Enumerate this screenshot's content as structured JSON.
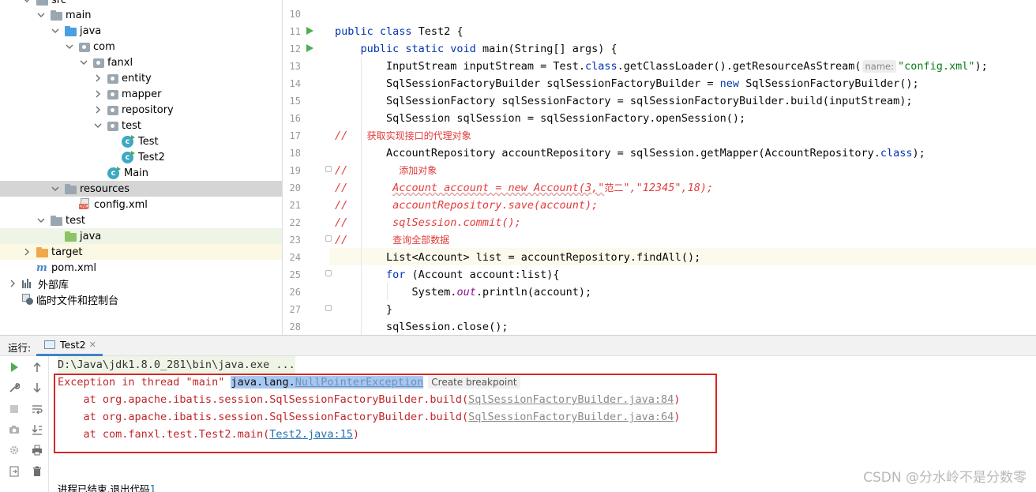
{
  "tree": {
    "items": [
      {
        "label": "src"
      },
      {
        "label": "main"
      },
      {
        "label": "java"
      },
      {
        "label": "com"
      },
      {
        "label": "fanxl"
      },
      {
        "label": "entity"
      },
      {
        "label": "mapper"
      },
      {
        "label": "repository"
      },
      {
        "label": "test"
      },
      {
        "label": "Test"
      },
      {
        "label": "Test2"
      },
      {
        "label": "Main"
      },
      {
        "label": "resources"
      },
      {
        "label": "config.xml"
      },
      {
        "label": "test"
      },
      {
        "label": "java"
      },
      {
        "label": "target"
      },
      {
        "label": "pom.xml"
      },
      {
        "label": "外部库"
      },
      {
        "label": "临时文件和控制台"
      }
    ]
  },
  "editor": {
    "line_numbers": [
      "10",
      "11",
      "12",
      "13",
      "14",
      "15",
      "16",
      "17",
      "18",
      "19",
      "20",
      "21",
      "22",
      "23",
      "24",
      "25",
      "26",
      "27",
      "28"
    ],
    "lines": {
      "l11_a": "public class",
      "l11_b": " Test2 {",
      "l12_a": "    public static void",
      "l12_b": " main(String[] args) {",
      "l13_a": "        InputStream inputStream = Test.",
      "l13_kw": "class",
      "l13_b": ".getClassLoader().getResourceAsStream(",
      "l13_hint": "name:",
      "l13_str": "\"config.xml\"",
      "l13_c": ");",
      "l14_a": "        SqlSessionFactoryBuilder sqlSessionFactoryBuilder = ",
      "l14_kw": "new",
      "l14_b": " SqlSessionFactoryBuilder();",
      "l15": "        SqlSessionFactory sqlSessionFactory = sqlSessionFactoryBuilder.build(inputStream);",
      "l16": "        SqlSession sqlSession = sqlSessionFactory.openSession();",
      "l17_a": "//   ",
      "l17_zh": "获取实现接口的代理对象",
      "l18_a": "        AccountRepository accountRepository = sqlSession.getMapper(AccountRepository.",
      "l18_kw": "class",
      "l18_b": ");",
      "l19_a": "//        ",
      "l19_zh": "添加对象",
      "l20_a": "//       ",
      "l20_b": "Account account = new Account(3,\"",
      "l20_zh": "范二",
      "l20_c": "\",\"12345\",18);",
      "l21": "//       accountRepository.save(account);",
      "l22": "//       sqlSession.commit();",
      "l23_a": "//       ",
      "l23_zh": "查询全部数据",
      "l24": "        List<Account> list = accountRepository.findAll();",
      "l25_kw": "        for",
      "l25_b": " (Account account:list){",
      "l26_a": "            System.",
      "l26_f": "out",
      "l26_b": ".println(account);",
      "l27": "        }",
      "l28": "        sqlSession.close();"
    }
  },
  "run": {
    "label": "运行:",
    "tab": "Test2",
    "cmd": "D:\\Java\\jdk1.8.0_281\\bin\\java.exe ...",
    "exc_prefix": "Exception in thread \"main\" ",
    "exc_pkg": "java.lang.",
    "exc_class": "NullPointerException",
    "create_bp": "Create breakpoint",
    "trace": [
      {
        "at": "    at org.apache.ibatis.session.SqlSessionFactoryBuilder.build(",
        "link": "SqlSessionFactoryBuilder.java:84",
        "end": ")"
      },
      {
        "at": "    at org.apache.ibatis.session.SqlSessionFactoryBuilder.build(",
        "link": "SqlSessionFactoryBuilder.java:64",
        "end": ")"
      },
      {
        "at": "    at com.fanxl.test.Test2.main(",
        "link": "Test2.java:15",
        "end": ")"
      }
    ],
    "exit_text": "进程已结束,退出代码",
    "exit_code": "1"
  },
  "watermark": "CSDN @分水岭不是分数零",
  "colors": {
    "keyword": "#0033b3",
    "comment": "#e33b3b",
    "string": "#067d17",
    "error": "#c0262a",
    "highlight_box": "#d92626"
  }
}
